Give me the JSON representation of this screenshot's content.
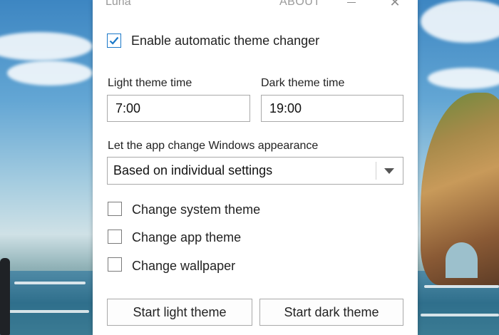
{
  "window": {
    "title": "Luna",
    "about_label": "ABOUT",
    "close_glyph": "✕"
  },
  "enable_changer": {
    "label": "Enable automatic theme changer",
    "checked": true
  },
  "light_time": {
    "label": "Light theme time",
    "value": "7:00"
  },
  "dark_time": {
    "label": "Dark theme time",
    "value": "19:00"
  },
  "appearance": {
    "label": "Let the app change Windows appearance",
    "selected": "Based on individual settings"
  },
  "options": [
    {
      "label": "Change system theme",
      "checked": false
    },
    {
      "label": "Change app theme",
      "checked": false
    },
    {
      "label": "Change wallpaper",
      "checked": false
    }
  ],
  "buttons": {
    "start_light": "Start light theme",
    "start_dark": "Start dark theme"
  },
  "colors": {
    "accent": "#1a78c8",
    "border": "#a9a9a9",
    "window_bg": "#ffffff"
  }
}
